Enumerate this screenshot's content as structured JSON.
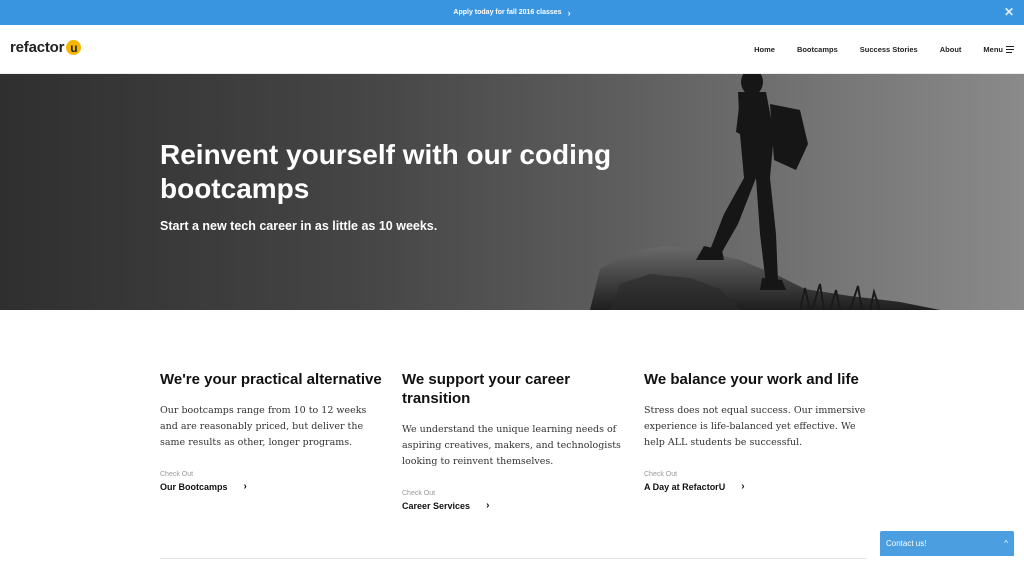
{
  "promo": {
    "text": "Apply today for fall 2016 classes",
    "chevron": "›",
    "close": "✕"
  },
  "header": {
    "logo_text": "refactor",
    "logo_badge": "u",
    "nav": [
      "Home",
      "Bootcamps",
      "Success Stories",
      "About"
    ],
    "menu_label": "Menu"
  },
  "hero": {
    "title": "Reinvent yourself with our coding bootcamps",
    "subtitle": "Start a new tech career in as little as 10 weeks."
  },
  "features": [
    {
      "title": "We're your practical alternative",
      "body": "Our bootcamps range from 10 to 12 weeks and are reasonably priced, but deliver the same results as other, longer programs.",
      "kicker": "Check Out",
      "cta": "Our Bootcamps"
    },
    {
      "title": "We support your career transition",
      "body": "We understand the unique learning needs of aspiring creatives, makers, and technologists looking to reinvent themselves.",
      "kicker": "Check Out",
      "cta": "Career Services"
    },
    {
      "title": "We balance your work and life",
      "body": "Stress does not equal success. Our immersive experience is life-balanced yet effective. We help ALL students be successful.",
      "kicker": "Check Out",
      "cta": "A Day at RefactorU"
    }
  ],
  "contact": {
    "label": "Contact us!",
    "chevron": "^"
  },
  "icons": {
    "arrow": "›"
  },
  "colors": {
    "promo_bar": "#3a95e0",
    "logo_badge": "#f5b700",
    "contact_bar": "#4b9fe1"
  }
}
